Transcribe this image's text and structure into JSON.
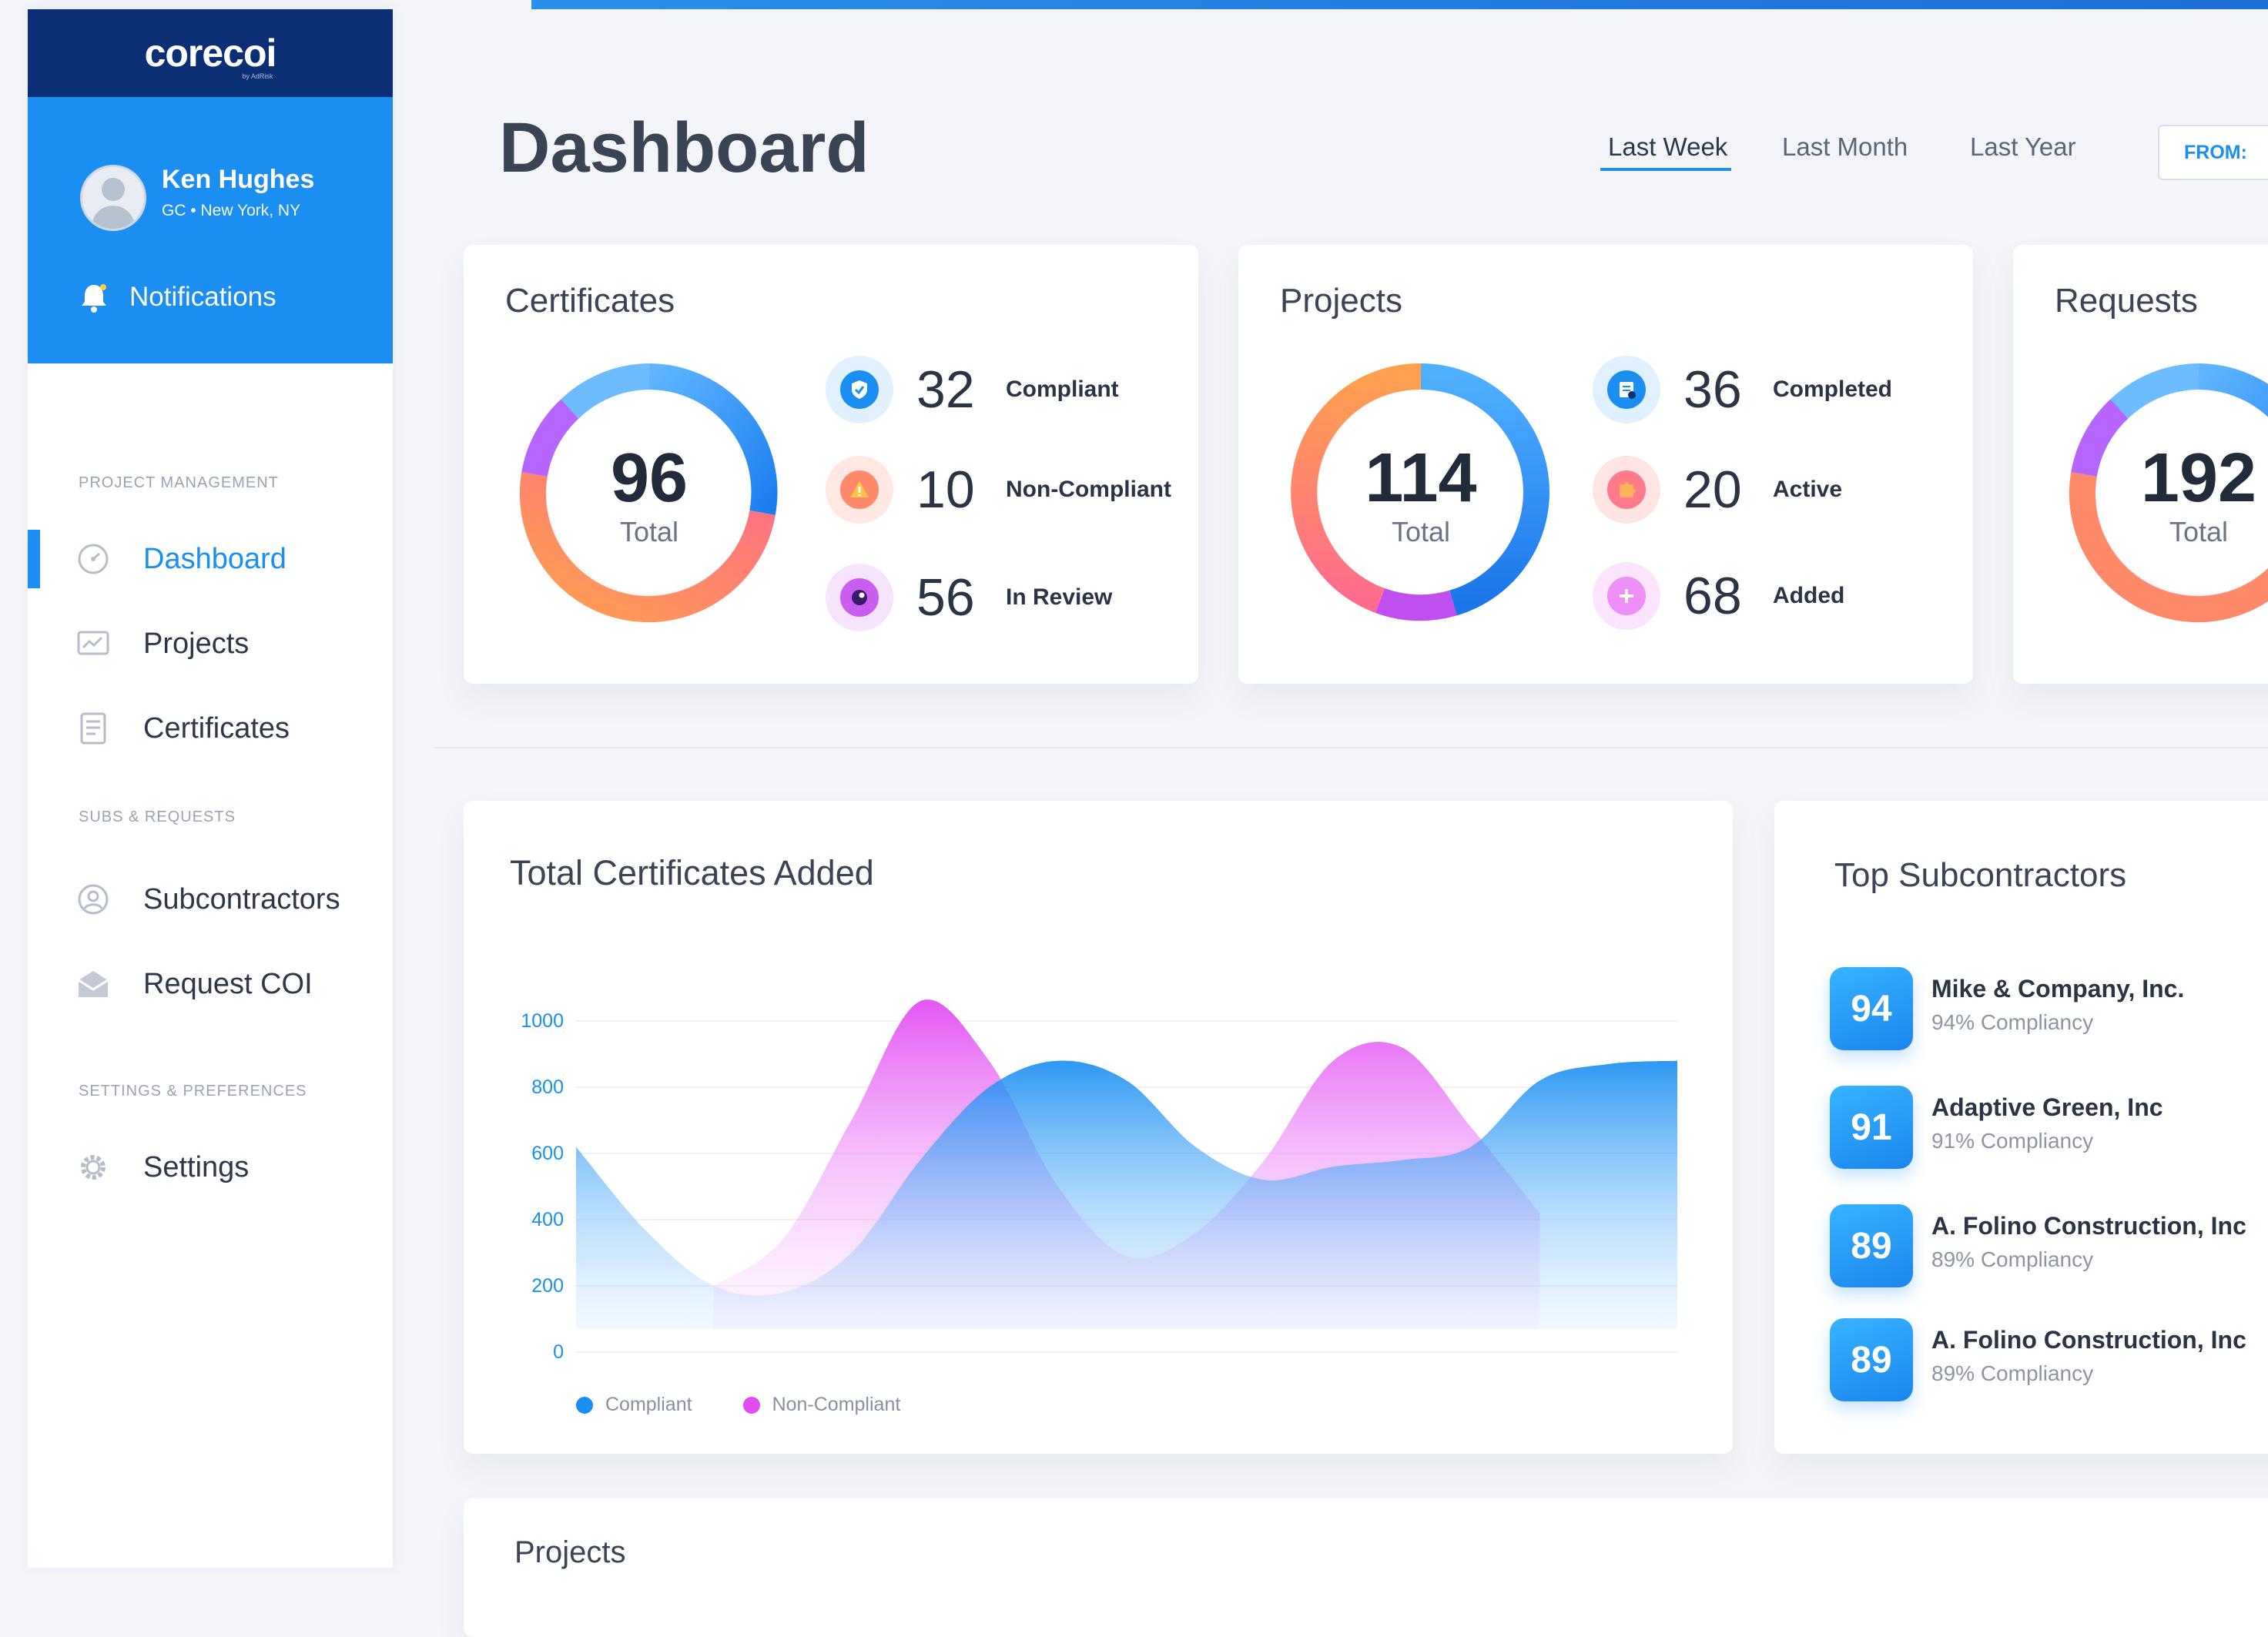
{
  "app": {
    "logo_text": "corecoi",
    "logo_sub": "by AdRisk"
  },
  "user": {
    "name": "Ken Hughes",
    "meta": "GC  •  New York, NY"
  },
  "notifications_label": "Notifications",
  "nav": {
    "section_project": "PROJECT MANAGEMENT",
    "section_subs": "SUBS & REQUESTS",
    "section_settings": "SETTINGS & PREFERENCES",
    "dashboard": "Dashboard",
    "projects": "Projects",
    "certificates": "Certificates",
    "subcontractors": "Subcontractors",
    "request_coi": "Request COI",
    "settings": "Settings"
  },
  "header": {
    "title": "Dashboard",
    "tabs": [
      "Last Week",
      "Last Month",
      "Last Year"
    ],
    "active_tab": "Last Week",
    "from_label": "FROM:"
  },
  "certificates": {
    "title": "Certificates",
    "total": "96",
    "total_label": "Total",
    "stats": [
      {
        "value": "32",
        "label": "Compliant",
        "icon": "shield-check-icon"
      },
      {
        "value": "10",
        "label": "Non-Compliant",
        "icon": "warning-icon"
      },
      {
        "value": "56",
        "label": "In Review",
        "icon": "eye-icon"
      }
    ]
  },
  "projects_card": {
    "title": "Projects",
    "total": "114",
    "total_label": "Total",
    "stats": [
      {
        "value": "36",
        "label": "Completed",
        "icon": "checklist-icon"
      },
      {
        "value": "20",
        "label": "Active",
        "icon": "puzzle-icon"
      },
      {
        "value": "68",
        "label": "Added",
        "icon": "plus-icon"
      }
    ]
  },
  "requests": {
    "title": "Requests",
    "total": "192",
    "total_label": "Total"
  },
  "chart_data": {
    "type": "area",
    "title": "Total Certificates Added",
    "xlabel": "",
    "ylabel": "",
    "ylim": [
      0,
      1000
    ],
    "yticks": [
      0,
      200,
      400,
      600,
      800,
      1000
    ],
    "x": [
      0,
      1,
      2,
      3,
      4,
      5,
      6,
      7,
      8,
      9,
      10,
      11,
      12,
      13,
      14,
      15,
      16
    ],
    "series": [
      {
        "name": "Compliant",
        "color": "#1b8ff1",
        "values": [
          620,
          370,
          200,
          180,
          300,
          580,
          800,
          880,
          820,
          620,
          520,
          560,
          580,
          620,
          820,
          870,
          880
        ]
      },
      {
        "name": "Non-Compliant",
        "color": "#e24df2",
        "values": [
          0,
          0,
          200,
          340,
          700,
          1060,
          880,
          500,
          290,
          360,
          580,
          880,
          920,
          680,
          420,
          0,
          0
        ]
      }
    ],
    "grid": true,
    "legend": "bottom-left"
  },
  "top_subs": {
    "title": "Top Subcontractors",
    "items": [
      {
        "score": "94",
        "name": "Mike & Company, Inc.",
        "compliance": "94% Compliancy"
      },
      {
        "score": "91",
        "name": "Adaptive Green, Inc",
        "compliance": "91% Compliancy"
      },
      {
        "score": "89",
        "name": "A. Folino Construction, Inc",
        "compliance": "89% Compliancy"
      },
      {
        "score": "89",
        "name": "A. Folino Construction, Inc",
        "compliance": "89% Compliancy"
      }
    ]
  },
  "projects_section_title": "Projects",
  "colors": {
    "accent": "#1b8ff1",
    "navy": "#0b2f74",
    "magenta": "#e24df2",
    "orange": "#ff9b57"
  }
}
